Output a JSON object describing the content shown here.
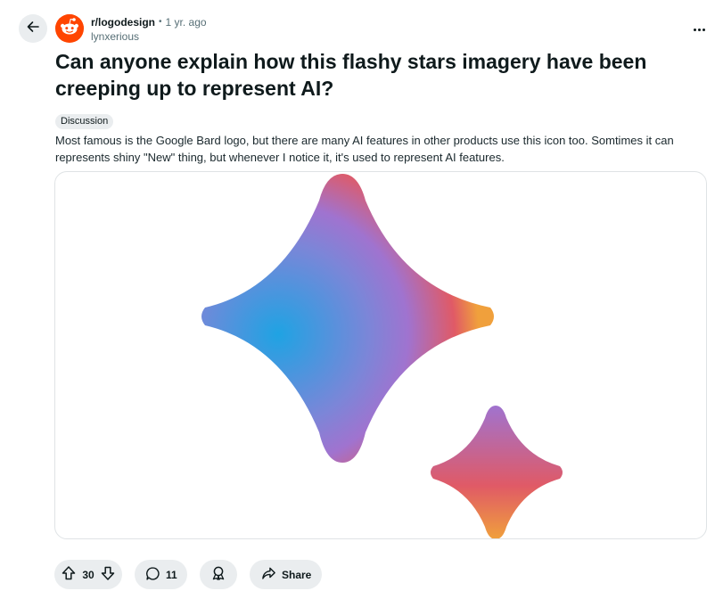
{
  "post": {
    "subreddit": "r/logodesign",
    "separator": "•",
    "age": "1 yr. ago",
    "author": "lynxerious",
    "title": "Can anyone explain how this flashy stars imagery have been creeping up to represent AI?",
    "flair": "Discussion",
    "body": "Most famous is the Google Bard logo, but there are many AI features in other products use this icon too. Somtimes it can represents shiny \"New\" thing, but whenever I notice it, it's used to represent AI features."
  },
  "actions": {
    "score": "30",
    "comments": "11",
    "share_label": "Share"
  },
  "icons": {
    "back": "arrow-left-icon",
    "subreddit": "reddit-snoo-icon",
    "more": "ellipsis-icon",
    "upvote": "upvote-arrow-icon",
    "downvote": "downvote-arrow-icon",
    "comment": "speech-bubble-icon",
    "award": "award-icon",
    "share": "share-arrow-icon"
  },
  "colors": {
    "brand": "#ff4500",
    "pill_bg": "#eaedef",
    "text": "#0f1a1c",
    "muted": "#576f76",
    "star_blue": "#1fa3e3",
    "star_purple": "#a073cf",
    "star_red": "#e05a66",
    "star_orange": "#f0a03c"
  }
}
